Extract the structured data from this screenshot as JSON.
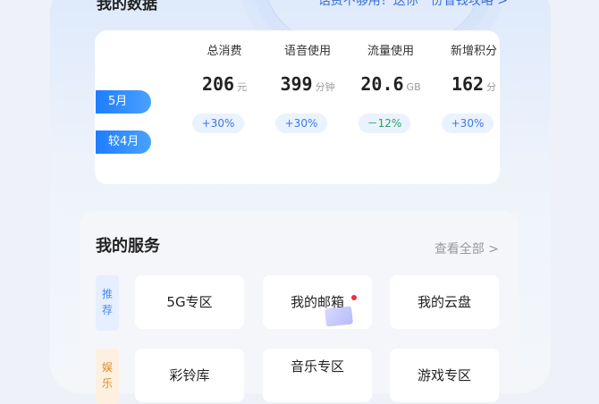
{
  "header": {
    "title": "我的数据",
    "link": "话费不够用？送你一份省钱攻略 >"
  },
  "data_card": {
    "columns": [
      {
        "label": "总消费",
        "value": "206",
        "unit": "元",
        "change": "+30%",
        "trend": "up"
      },
      {
        "label": "语音使用",
        "value": "399",
        "unit": "分钟",
        "change": "+30%",
        "trend": "up"
      },
      {
        "label": "流量使用",
        "value": "20.6",
        "unit": "GB",
        "change": "－12%",
        "trend": "down"
      },
      {
        "label": "新增积分",
        "value": "162",
        "unit": "分",
        "change": "+30%",
        "trend": "up"
      }
    ],
    "row_tags": {
      "current": "5月",
      "compare": "较4月"
    }
  },
  "services": {
    "title": "我的服务",
    "more": "查看全部 >",
    "groups": [
      {
        "tag_chars": [
          "推",
          "荐"
        ],
        "tag_color": "#4a8af0",
        "tag_bg": "#e6efff",
        "items": [
          "5G专区",
          "我的邮箱",
          "我的云盘"
        ]
      },
      {
        "tag_chars": [
          "娱",
          "乐"
        ],
        "tag_color": "#e08a2c",
        "tag_bg": "#fdf0e0",
        "items": [
          "彩铃库",
          "音乐专区",
          "游戏专区"
        ]
      }
    ]
  },
  "colors": {
    "accent": "#1e7dff",
    "up": "#3b78e6",
    "down": "#2aa165",
    "badge": "#f02d45"
  }
}
